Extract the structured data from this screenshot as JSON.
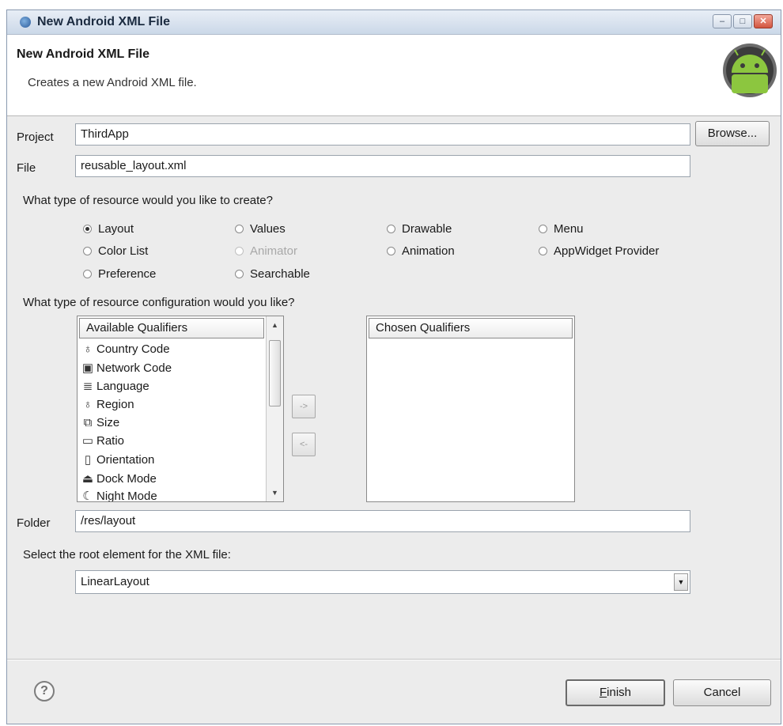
{
  "window": {
    "title": "New Android XML File",
    "controls": {
      "minimize": "–",
      "maximize": "□",
      "close": "✕"
    }
  },
  "header": {
    "title": "New Android XML File",
    "description": "Creates a new Android XML file.",
    "logo_icon": "android-logo-icon"
  },
  "form": {
    "project_label": "Project",
    "project_value": "ThirdApp",
    "browse_label": "Browse...",
    "file_label": "File",
    "file_value": "reusable_layout.xml",
    "resource_type_question": "What type of resource would you like to create?",
    "resource_types": [
      {
        "label": "Layout",
        "selected": true,
        "enabled": true
      },
      {
        "label": "Values",
        "selected": false,
        "enabled": true
      },
      {
        "label": "Drawable",
        "selected": false,
        "enabled": true
      },
      {
        "label": "Menu",
        "selected": false,
        "enabled": true
      },
      {
        "label": "Color List",
        "selected": false,
        "enabled": true
      },
      {
        "label": "Animator",
        "selected": false,
        "enabled": false
      },
      {
        "label": "Animation",
        "selected": false,
        "enabled": true
      },
      {
        "label": "AppWidget Provider",
        "selected": false,
        "enabled": true
      },
      {
        "label": "Preference",
        "selected": false,
        "enabled": true
      },
      {
        "label": "Searchable",
        "selected": false,
        "enabled": true
      }
    ],
    "config_question": "What type of resource configuration would you like?",
    "available_header": "Available Qualifiers",
    "available_qualifiers": [
      {
        "label": "Country Code",
        "icon": "globe-icon"
      },
      {
        "label": "Network Code",
        "icon": "network-icon"
      },
      {
        "label": "Language",
        "icon": "language-icon"
      },
      {
        "label": "Region",
        "icon": "globe-icon"
      },
      {
        "label": "Size",
        "icon": "size-icon"
      },
      {
        "label": "Ratio",
        "icon": "ratio-icon"
      },
      {
        "label": "Orientation",
        "icon": "orientation-icon"
      },
      {
        "label": "Dock Mode",
        "icon": "dock-icon"
      },
      {
        "label": "Night Mode",
        "icon": "night-icon"
      }
    ],
    "chosen_header": "Chosen Qualifiers",
    "add_button": "->",
    "remove_button": "<-",
    "folder_label": "Folder",
    "folder_value": "/res/layout",
    "root_element_question": "Select the root element for the XML file:",
    "root_element_value": "LinearLayout"
  },
  "footer": {
    "help_icon": "help-icon",
    "help_glyph": "?",
    "finish_mnemonic": "F",
    "finish_rest": "inish",
    "cancel_label": "Cancel"
  }
}
